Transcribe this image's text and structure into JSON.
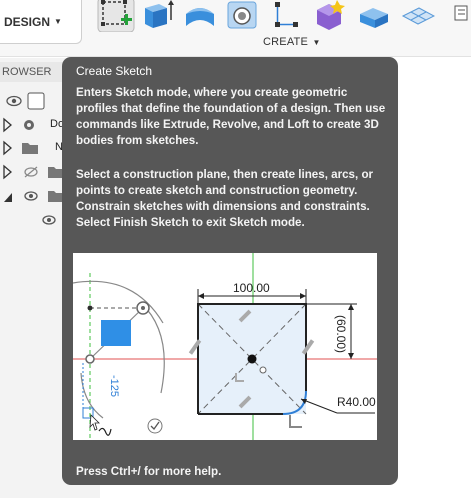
{
  "toolbar": {
    "workspace_label": "DESIGN",
    "group_label": "CREATE",
    "tools": [
      {
        "icon": "create-sketch-icon"
      },
      {
        "icon": "extrude-icon"
      },
      {
        "icon": "revolve-icon"
      },
      {
        "icon": "hole-icon"
      },
      {
        "icon": "construct-points-icon"
      },
      {
        "icon": "form-icon"
      },
      {
        "icon": "box-icon"
      },
      {
        "icon": "plane-icon"
      }
    ]
  },
  "browser": {
    "title": "ROWSER",
    "rows": [
      {
        "label": ""
      },
      {
        "label": "Do"
      },
      {
        "label": "N"
      },
      {
        "label": ""
      },
      {
        "label": ""
      },
      {
        "label": ""
      }
    ]
  },
  "tooltip": {
    "title": "Create Sketch",
    "paragraph1": "Enters Sketch mode, where you create geometric profiles that define the foundation of a design. Then use commands like Extrude, Revolve, and Loft to create 3D bodies from sketches.",
    "paragraph2": "Select a construction plane, then create lines, arcs, or points to create sketch and construction geometry. Constrain sketches with dimensions and constraints. Select Finish Sketch to exit Sketch mode.",
    "footer": "Press Ctrl+/ for more help.",
    "image": {
      "dim_width": "100.00",
      "dim_height": "(60.00)",
      "dim_radius": "R40.00",
      "dim_vertical": "-125"
    }
  },
  "colors": {
    "tooltip_bg": "#575757",
    "accent_blue": "#2f7fd6",
    "axis_red": "#e05050",
    "axis_green": "#3fbf3f"
  }
}
